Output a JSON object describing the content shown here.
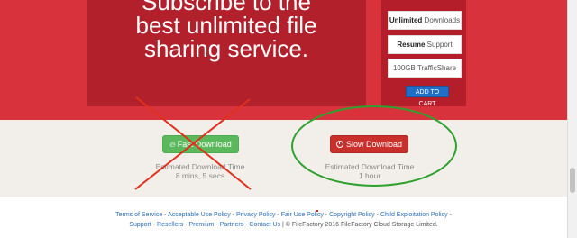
{
  "promo": {
    "line1": "Subscribe to the",
    "line2": "best unlimited file",
    "line3": "sharing service."
  },
  "plan": {
    "features": [
      {
        "bold": "Unlimited",
        "rest": " Downloads"
      },
      {
        "bold": "Resume",
        "rest": " Support"
      },
      {
        "bold": "",
        "rest": "100GB TrafficShare"
      }
    ],
    "cart_button": "ADD TO CART"
  },
  "download": {
    "fast_label": "Fast Download",
    "fast_icon": "flame-icon",
    "fast_est_label": "Estimated Download Time",
    "fast_est_value": "8 mins, 5 secs",
    "slow_label": "Slow Download",
    "slow_icon": "clock-icon",
    "slow_est_label": "Estimated Download Time",
    "slow_est_value": "1 hour"
  },
  "annotations": {
    "cross_color": "#e0301e",
    "circle_color": "#2ea12e"
  },
  "footer": {
    "row1": [
      "Terms of Service",
      "Acceptable Use Policy",
      "Privacy Policy",
      "Fair Use Policy",
      "Copyright Policy",
      "Child Exploitation Policy"
    ],
    "row2": [
      "Support",
      "Resellers",
      "Premium",
      "Partners",
      "Contact Us"
    ],
    "copyright": "| © FileFactory 2016 FileFactory Cloud Storage Limited."
  },
  "colors": {
    "hero_bg": "#d8333c",
    "promo_bg": "#b2202c",
    "fast_btn": "#5cb85c",
    "slow_btn": "#c9302c",
    "link": "#2a6ebb"
  }
}
